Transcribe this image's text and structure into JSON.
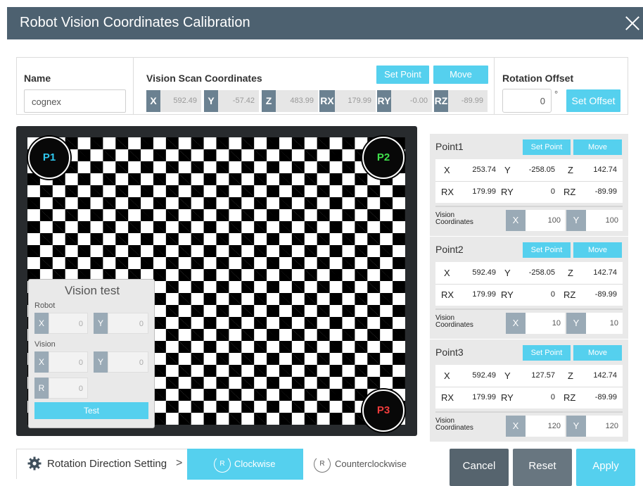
{
  "window": {
    "title": "Robot Vision Coordinates Calibration"
  },
  "top": {
    "name_label": "Name",
    "name_value": "cognex",
    "scan_label": "Vision Scan Coordinates",
    "set_point": "Set Point",
    "move": "Move",
    "coords": [
      {
        "label": "X",
        "value": "592.49"
      },
      {
        "label": "Y",
        "value": "-57.42"
      },
      {
        "label": "Z",
        "value": "483.99"
      },
      {
        "label": "RX",
        "value": "179.99"
      },
      {
        "label": "RY",
        "value": "-0.00"
      },
      {
        "label": "RZ",
        "value": "-89.99"
      }
    ],
    "rotation_label": "Rotation Offset",
    "rotation_value": "0",
    "degree": "°",
    "set_offset": "Set Offset"
  },
  "board": {
    "markers": [
      {
        "label": "P1",
        "color": "#2ec7ee"
      },
      {
        "label": "P2",
        "color": "#3fe04b"
      },
      {
        "label": "P3",
        "color": "#f03c3c"
      }
    ]
  },
  "vision_test": {
    "title": "Vision test",
    "robot_label": "Robot",
    "vision_label": "Vision",
    "robot_x_label": "X",
    "robot_x": "0",
    "robot_y_label": "Y",
    "robot_y": "0",
    "vision_x_label": "X",
    "vision_x": "0",
    "vision_y_label": "Y",
    "vision_y": "0",
    "vision_r_label": "R",
    "vision_r": "0",
    "test_button": "Test"
  },
  "points": [
    {
      "title": "Point1",
      "set_point": "Set Point",
      "move": "Move",
      "x": "253.74",
      "y": "-258.05",
      "z": "142.74",
      "rx": "179.99",
      "ry": "0",
      "rz": "-89.99",
      "vision_label_1": "Vision",
      "vision_label_2": "Coordinates",
      "vx": "100",
      "vy": "100"
    },
    {
      "title": "Point2",
      "set_point": "Set Point",
      "move": "Move",
      "x": "592.49",
      "y": "-258.05",
      "z": "142.74",
      "rx": "179.99",
      "ry": "0",
      "rz": "-89.99",
      "vision_label_1": "Vision",
      "vision_label_2": "Coordinates",
      "vx": "10",
      "vy": "10"
    },
    {
      "title": "Point3",
      "set_point": "Set Point",
      "move": "Move",
      "x": "592.49",
      "y": "127.57",
      "z": "142.74",
      "rx": "179.99",
      "ry": "0",
      "rz": "-89.99",
      "vision_label_1": "Vision",
      "vision_label_2": "Coordinates",
      "vx": "120",
      "vy": "120"
    }
  ],
  "axis_labels": {
    "x": "X",
    "y": "Y",
    "z": "Z",
    "rx": "RX",
    "ry": "RY",
    "rz": "RZ"
  },
  "rotation_dir": {
    "label": "Rotation Direction Setting",
    "chevron": ">",
    "clockwise": "Clockwise",
    "counterclockwise": "Counterclockwise",
    "icon_letter": "R",
    "selected": "Clockwise"
  },
  "actions": {
    "cancel": "Cancel",
    "reset": "Reset",
    "apply": "Apply"
  },
  "colors": {
    "header": "#4d6170",
    "accent": "#55d0ee",
    "label_bg": "#6b8191",
    "cancel": "#56646e",
    "reset": "#687680"
  }
}
